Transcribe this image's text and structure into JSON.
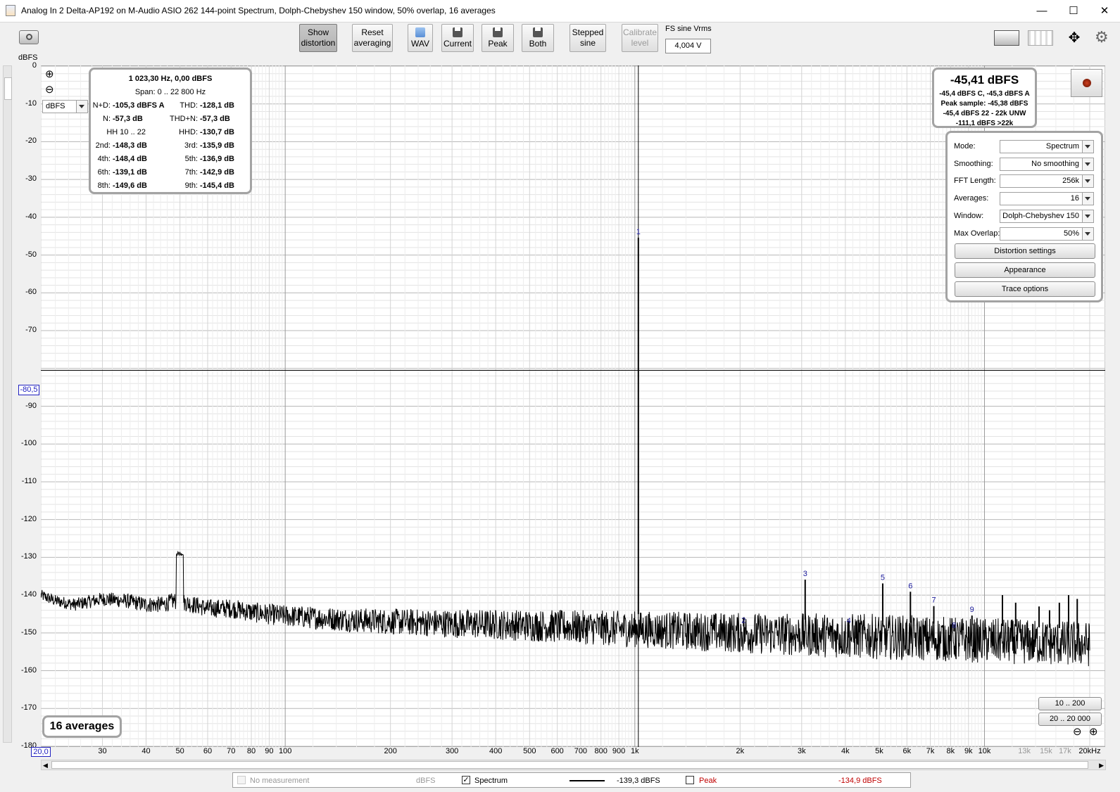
{
  "window": {
    "title": "Analog In 2 Delta-AP192 on M-Audio ASIO 262 144-point Spectrum, Dolph-Chebyshev 150 window, 50% overlap, 16 averages",
    "minimize": "—",
    "maximize": "☐",
    "close": "✕"
  },
  "toolbar": {
    "show_distortion": [
      "Show",
      "distortion"
    ],
    "reset_averaging": [
      "Reset",
      "averaging"
    ],
    "wav": "WAV",
    "current": "Current",
    "peak": "Peak",
    "both": "Both",
    "stepped_sine": [
      "Stepped",
      "sine"
    ],
    "calibrate_level": [
      "Calibrate",
      "level"
    ],
    "fs_label": "FS sine Vrms",
    "fs_value": "4,004 V"
  },
  "axis": {
    "y_unit": "dBFS",
    "y_unit_select": "dBFS",
    "cursor_level": "-80,5",
    "x_start": "20,0"
  },
  "stats": {
    "header": "1 023,30 Hz, 0,00 dBFS",
    "span": "Span: 0 .. 22 800 Hz",
    "rows": [
      {
        "l1": "N+D:",
        "v1": "-105,3 dBFS A",
        "l2": "THD:",
        "v2": "-128,1 dB"
      },
      {
        "l1": "N:",
        "v1": "-57,3 dB",
        "l2": "THD+N:",
        "v2": "-57,3 dB"
      },
      {
        "l1": "HH 10 .. 22",
        "v1": "",
        "l2": "HHD:",
        "v2": "-130,7 dB"
      },
      {
        "l1": "2nd:",
        "v1": "-148,3 dB",
        "l2": "3rd:",
        "v2": "-135,9 dB"
      },
      {
        "l1": "4th:",
        "v1": "-148,4 dB",
        "l2": "5th:",
        "v2": "-136,9 dB"
      },
      {
        "l1": "6th:",
        "v1": "-139,1 dB",
        "l2": "7th:",
        "v2": "-142,9 dB"
      },
      {
        "l1": "8th:",
        "v1": "-149,6 dB",
        "l2": "9th:",
        "v2": "-145,4 dB"
      }
    ]
  },
  "level": {
    "main": "-45,41 dBFS",
    "lines": [
      "-45,4 dBFS C, -45,3 dBFS A",
      "Peak sample: -45,38 dBFS",
      "-45,4 dBFS 22 - 22k UNW",
      "-111,1 dBFS >22k"
    ]
  },
  "controls": {
    "rows": [
      {
        "label": "Mode:",
        "value": "Spectrum"
      },
      {
        "label": "Smoothing:",
        "value": "No  smoothing"
      },
      {
        "label": "FFT Length:",
        "value": "256k"
      },
      {
        "label": "Averages:",
        "value": "16"
      },
      {
        "label": "Window:",
        "value": "Dolph-Chebyshev 150"
      },
      {
        "label": "Max Overlap:",
        "value": "50%"
      }
    ],
    "distortion_settings": "Distortion settings",
    "appearance": "Appearance",
    "trace_options": "Trace options"
  },
  "averages_badge": "16 averages",
  "zoom": {
    "range1": "10 .. 200",
    "range2": "20 .. 20 000"
  },
  "legend": {
    "no_measurement": "No measurement",
    "no_measurement_unit": "dBFS",
    "spectrum": "Spectrum",
    "spectrum_value": "-139,3 dBFS",
    "peak": "Peak",
    "peak_value": "-134,9 dBFS"
  },
  "colors": {
    "trace": "#000000",
    "harmonic_label": "#1a1a9a",
    "peak_text": "#c00000",
    "grid_major": "#b8b8b8",
    "grid_minor": "#e3e3e3"
  },
  "chart_data": {
    "type": "line",
    "x_scale": "log",
    "xlim": [
      20,
      20000
    ],
    "ylim": [
      -180,
      0
    ],
    "ylabel": "dBFS",
    "y_ticks": [
      0,
      -10,
      -20,
      -30,
      -40,
      -50,
      -60,
      -70,
      -90,
      -100,
      -110,
      -120,
      -130,
      -140,
      -150,
      -160,
      -170,
      -180
    ],
    "x_ticks": [
      {
        "v": 30,
        "t": "30"
      },
      {
        "v": 40,
        "t": "40"
      },
      {
        "v": 50,
        "t": "50"
      },
      {
        "v": 60,
        "t": "60"
      },
      {
        "v": 70,
        "t": "70"
      },
      {
        "v": 80,
        "t": "80"
      },
      {
        "v": 90,
        "t": "90"
      },
      {
        "v": 100,
        "t": "100"
      },
      {
        "v": 200,
        "t": "200"
      },
      {
        "v": 300,
        "t": "300"
      },
      {
        "v": 400,
        "t": "400"
      },
      {
        "v": 500,
        "t": "500"
      },
      {
        "v": 600,
        "t": "600"
      },
      {
        "v": 700,
        "t": "700"
      },
      {
        "v": 800,
        "t": "800"
      },
      {
        "v": 900,
        "t": "900"
      },
      {
        "v": 1000,
        "t": "1k"
      },
      {
        "v": 2000,
        "t": "2k"
      },
      {
        "v": 3000,
        "t": "3k"
      },
      {
        "v": 4000,
        "t": "4k"
      },
      {
        "v": 5000,
        "t": "5k"
      },
      {
        "v": 6000,
        "t": "6k"
      },
      {
        "v": 7000,
        "t": "7k"
      },
      {
        "v": 8000,
        "t": "8k"
      },
      {
        "v": 9000,
        "t": "9k"
      },
      {
        "v": 10000,
        "t": "10k"
      },
      {
        "v": 13000,
        "t": "13k",
        "gray": true
      },
      {
        "v": 15000,
        "t": "15k",
        "gray": true
      },
      {
        "v": 17000,
        "t": "17k",
        "gray": true
      },
      {
        "v": 20000,
        "t": "20kHz"
      }
    ],
    "cursor_y": -80.5,
    "cursor_x": 1023.3,
    "grid": true,
    "series": [
      {
        "points": [
          [
            20,
            -140
          ],
          [
            22,
            -141.5
          ],
          [
            25,
            -142.5
          ],
          [
            30,
            -141
          ],
          [
            35,
            -141.5
          ],
          [
            40,
            -142.5
          ],
          [
            45,
            -142.5
          ],
          [
            48,
            -141.5
          ],
          [
            50,
            -129
          ],
          [
            52,
            -142
          ],
          [
            60,
            -143.5
          ],
          [
            70,
            -143.5
          ],
          [
            80,
            -144.5
          ],
          [
            100,
            -145.5
          ],
          [
            150,
            -146.5
          ],
          [
            200,
            -147
          ],
          [
            300,
            -147.5
          ],
          [
            500,
            -148
          ],
          [
            700,
            -148.5
          ],
          [
            1000,
            -149
          ],
          [
            2000,
            -150
          ],
          [
            5000,
            -151
          ],
          [
            10000,
            -152
          ],
          [
            20000,
            -153
          ]
        ],
        "noise_amplitude_db": [
          1.5,
          6
        ],
        "spikes": [
          {
            "f": 1023.3,
            "db": -45.4,
            "label": "1"
          },
          {
            "f": 2046.6,
            "db": -148.3,
            "label": "2"
          },
          {
            "f": 3069.9,
            "db": -135.9,
            "label": "3"
          },
          {
            "f": 4093.2,
            "db": -148.4,
            "label": "4"
          },
          {
            "f": 5116.5,
            "db": -136.9,
            "label": "5"
          },
          {
            "f": 6139.8,
            "db": -139.1,
            "label": "6"
          },
          {
            "f": 7163.1,
            "db": -142.9,
            "label": "7"
          },
          {
            "f": 8186.4,
            "db": -149.6,
            "label": "8"
          },
          {
            "f": 9209.7,
            "db": -145.4,
            "label": "9"
          },
          {
            "f": 11256,
            "db": -140
          },
          {
            "f": 12280,
            "db": -142
          },
          {
            "f": 14326,
            "db": -143
          },
          {
            "f": 15350,
            "db": -144
          },
          {
            "f": 16373,
            "db": -142
          },
          {
            "f": 17400,
            "db": -140
          },
          {
            "f": 18420,
            "db": -141
          }
        ]
      }
    ]
  }
}
